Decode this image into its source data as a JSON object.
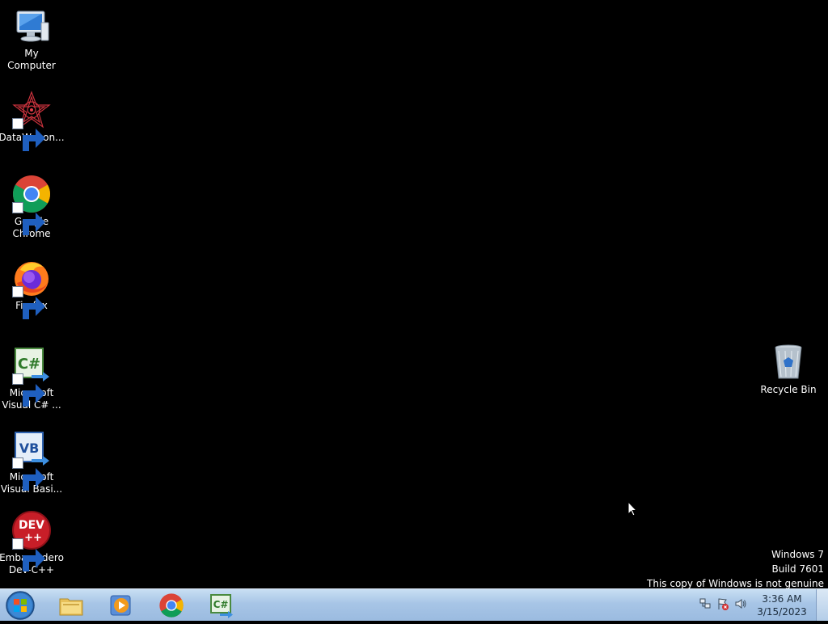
{
  "desktop_icons": [
    {
      "label": "My Computer",
      "icon": "computer-icon"
    },
    {
      "label": "DataWagon...",
      "icon": "datawagon-icon"
    },
    {
      "label": "Google\nChrome",
      "icon": "chrome-icon"
    },
    {
      "label": "Firefox",
      "icon": "firefox-icon"
    },
    {
      "label": "Microsoft\nVisual C# ...",
      "icon": "visual-csharp-icon"
    },
    {
      "label": "Microsoft\nVisual Basi...",
      "icon": "visual-basic-icon"
    },
    {
      "label": "Embarcadero\nDev-C++",
      "icon": "devcpp-icon"
    }
  ],
  "recycle_bin": {
    "label": "Recycle Bin",
    "icon": "recycle-bin-icon"
  },
  "watermark": {
    "line1": "Windows 7",
    "line2": "Build 7601",
    "line3": "This copy of Windows is not genuine"
  },
  "taskbar": {
    "pinned": [
      {
        "name": "windows-explorer",
        "icon": "folder-icon"
      },
      {
        "name": "media-player",
        "icon": "media-player-icon"
      },
      {
        "name": "chrome",
        "icon": "chrome-icon"
      },
      {
        "name": "visual-csharp",
        "icon": "visual-csharp-icon"
      }
    ],
    "clock": {
      "time": "3:36 AM",
      "date": "3/15/2023"
    }
  },
  "colors": {
    "desktop_bg": "#000000",
    "taskbar": "#a7c5e6",
    "text": "#ffffff"
  },
  "overlay_text": {
    "csharp": "C#",
    "vb": "VB",
    "dev": "DEV",
    "dev_plus": "++"
  }
}
